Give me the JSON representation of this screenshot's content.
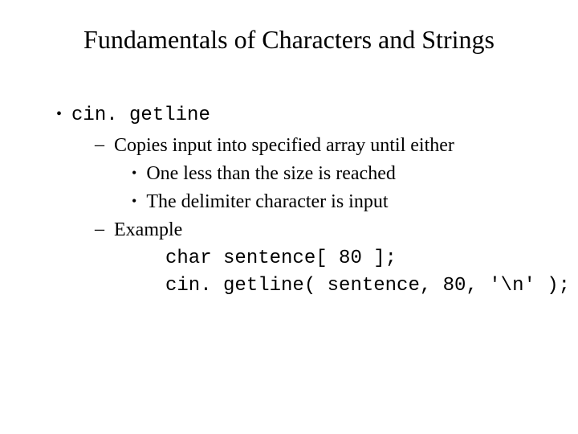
{
  "title": "Fundamentals of Characters and Strings",
  "item1": "cin. getline",
  "sub1": "Copies input into specified array until either",
  "sub1a": "One less than the size is reached",
  "sub1b": "The delimiter character is input",
  "sub2": "Example",
  "code1": "char sentence[ 80 ];",
  "code2": "cin. getline( sentence, 80, '\\n' );",
  "markers": {
    "dot": "•",
    "dash": "–"
  }
}
